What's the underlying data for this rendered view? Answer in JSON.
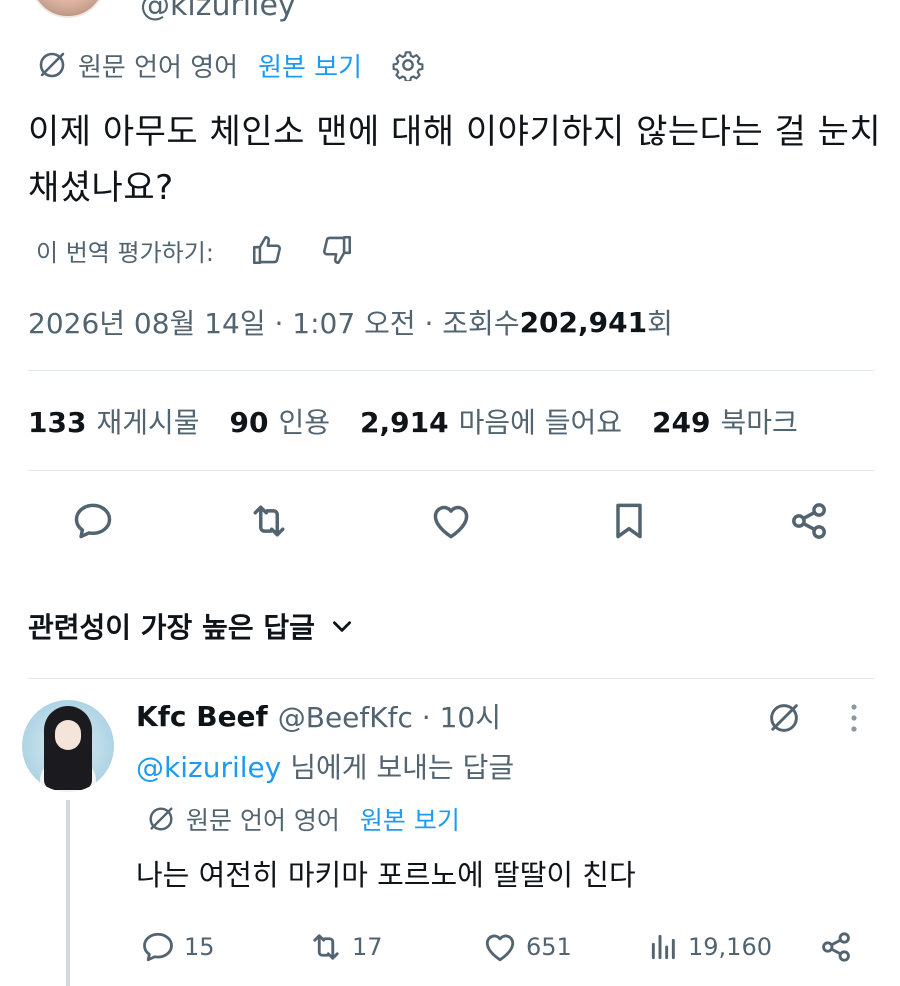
{
  "author": {
    "handle": "@kizuriley"
  },
  "translation": {
    "source_label": "원문 언어 영어",
    "view_original": "원본 보기"
  },
  "tweet": {
    "text": "이제 아무도 체인소 맨에 대해 이야기하지 않는다는 걸 눈치채셨나요?",
    "rate_label": "이 번역 평가하기:",
    "timestamp": "2026년 08월 14일 · 1:07 오전 · 조회수 ",
    "views_count": "202,941",
    "views_suffix": "회"
  },
  "stats": {
    "reposts_count": "133",
    "reposts_label": "재게시물",
    "quotes_count": "90",
    "quotes_label": "인용",
    "likes_count": "2,914",
    "likes_label": "마음에 들어요",
    "bookmarks_count": "249",
    "bookmarks_label": "북마크"
  },
  "sort": {
    "label": "관련성이 가장 높은 답글"
  },
  "reply": {
    "name": "Kfc Beef",
    "handle": "@BeefKfc · 10시",
    "reply_to_handle": "@kizuriley",
    "reply_to_suffix": " 님에게 보내는 답글",
    "translation_source": "원문 언어 영어",
    "translation_view": "원본 보기",
    "text": "나는 여전히 마키마 포르노에 딸딸이 친다",
    "replies": "15",
    "reposts": "17",
    "likes": "651",
    "views": "19,160"
  },
  "icons": {
    "translate": "translate-icon",
    "gear": "gear-icon",
    "thumbs_up": "thumbs-up-icon",
    "thumbs_down": "thumbs-down-icon",
    "reply": "reply-icon",
    "repost": "repost-icon",
    "like": "heart-icon",
    "bookmark": "bookmark-icon",
    "share": "share-icon",
    "views": "views-icon",
    "more": "more-icon",
    "chevron": "chevron-down-icon"
  },
  "colors": {
    "accent": "#1d9bf0",
    "text": "#0f1419",
    "secondary": "#536471",
    "divider": "#e1e6ea"
  }
}
